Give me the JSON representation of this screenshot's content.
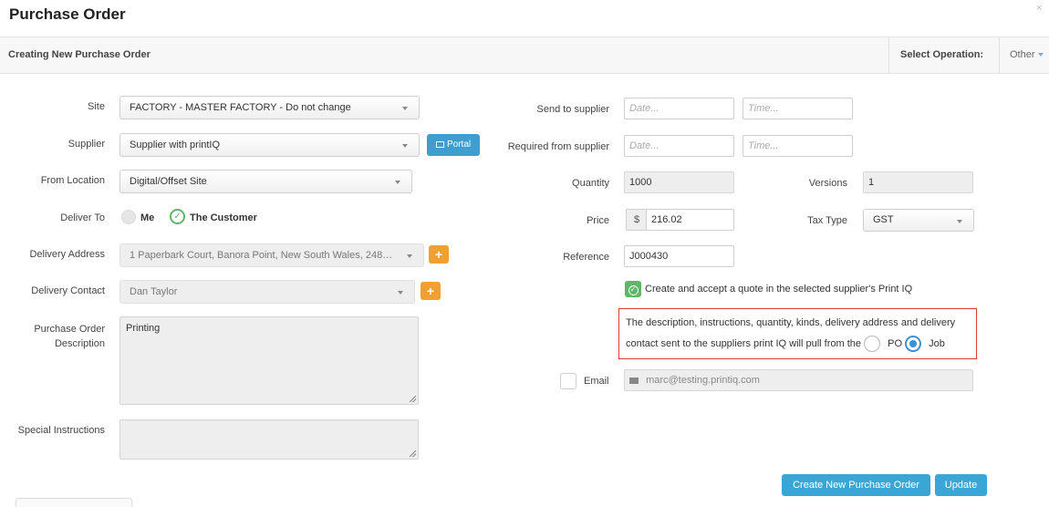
{
  "dialog": {
    "title": "Purchase Order",
    "close_glyph": "×"
  },
  "subbar": {
    "subtitle": "Creating New Purchase Order",
    "select_operation_label": "Select Operation:",
    "operation_value": "Other"
  },
  "left": {
    "site": {
      "label": "Site",
      "value": "FACTORY - MASTER FACTORY - Do not change"
    },
    "supplier": {
      "label": "Supplier",
      "value": "Supplier with printIQ",
      "portal_label": "Portal"
    },
    "from_location": {
      "label": "From Location",
      "value": "Digital/Offset Site"
    },
    "deliver_to": {
      "label": "Deliver To",
      "option_me": "Me",
      "option_customer": "The Customer"
    },
    "delivery_address": {
      "label": "Delivery Address",
      "value": "1 Paperbark Court, Banora Point, New South Wales, 248…",
      "add_glyph": "+"
    },
    "delivery_contact": {
      "label": "Delivery Contact",
      "value": "Dan Taylor",
      "add_glyph": "+"
    },
    "po_description": {
      "label_line1": "Purchase Order",
      "label_line2": "Description",
      "value": "Printing"
    },
    "special_instructions": {
      "label": "Special Instructions",
      "value": ""
    }
  },
  "right": {
    "send_to_supplier": {
      "label": "Send to supplier",
      "date_placeholder": "Date...",
      "time_placeholder": "Time..."
    },
    "required_from_supplier": {
      "label": "Required from supplier",
      "date_placeholder": "Date...",
      "time_placeholder": "Time..."
    },
    "quantity": {
      "label": "Quantity",
      "value": "1000"
    },
    "versions": {
      "label": "Versions",
      "value": "1"
    },
    "price": {
      "label": "Price",
      "currency": "$",
      "value": "216.02"
    },
    "tax_type": {
      "label": "Tax Type",
      "value": "GST"
    },
    "reference": {
      "label": "Reference",
      "value": "J000430"
    },
    "quote_checkbox": {
      "label": "Create and accept a quote in the selected supplier's Print IQ"
    },
    "pull_notice": {
      "line1": "The description, instructions, quantity, kinds, delivery address and delivery",
      "line2": "contact sent to the suppliers print IQ will pull from the",
      "option_po": "PO",
      "option_job": "Job"
    },
    "email": {
      "label": "Email",
      "value": "marc@testing.printiq.com"
    }
  },
  "footer": {
    "create_button": "Create New Purchase Order",
    "update_button": "Update"
  },
  "colors": {
    "accent_blue": "#3aa6d6",
    "add_orange": "#f0a030",
    "check_green": "#5db765",
    "notice_red": "#dd3b3b"
  }
}
